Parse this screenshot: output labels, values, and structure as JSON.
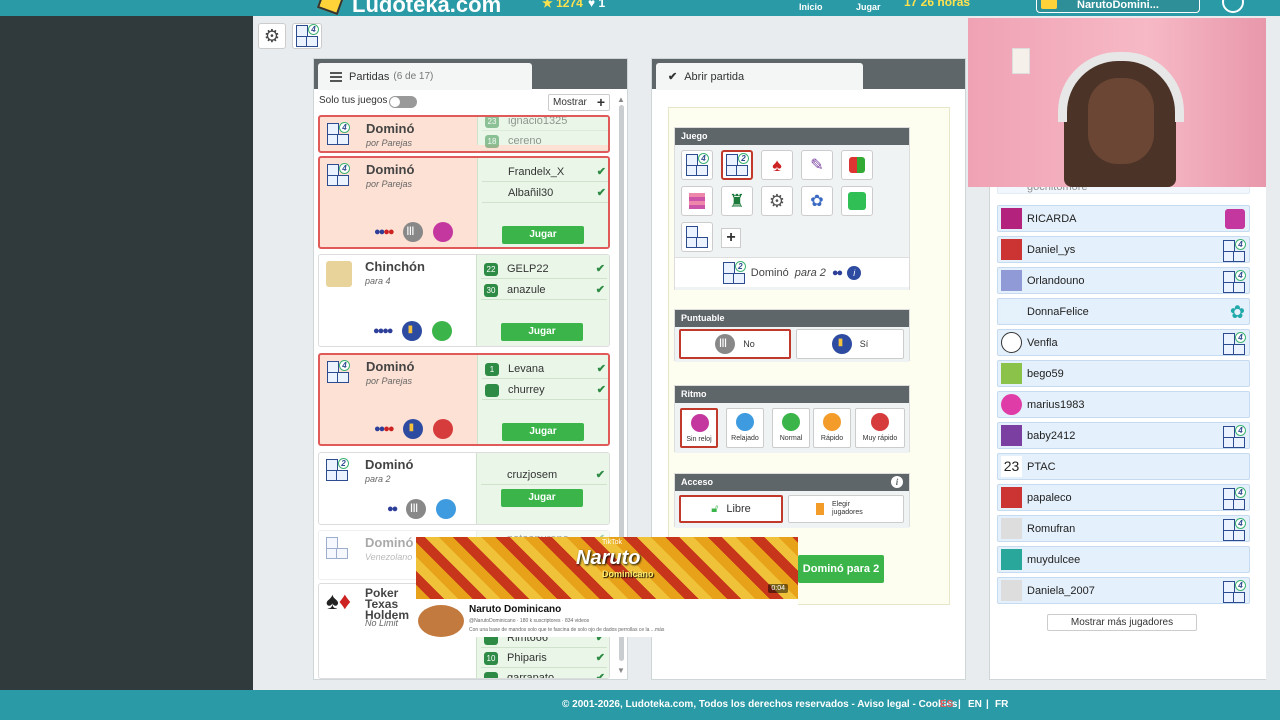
{
  "topbar": {
    "logo": "Ludoteka.com",
    "stat_stars": "1274",
    "stat_hearts": "1",
    "nav_inicio": "Inicio",
    "nav_jugar": "Jugar",
    "hours": "17 26 horas",
    "username": "NarutoDomini..."
  },
  "partidas": {
    "title": "Partidas",
    "count": "(6 de 17)",
    "filter_label": "Solo tus juegos",
    "mostrar": "Mostrar",
    "jugar": "Jugar",
    "games": [
      {
        "name": "Dominó",
        "sub": "por Parejas",
        "players": [
          "ignacio1325",
          "cereno"
        ],
        "levels": [
          "23",
          "18"
        ]
      },
      {
        "name": "Dominó",
        "sub": "por Parejas",
        "players": [
          "Frandelx_X",
          "Albañil30"
        ]
      },
      {
        "name": "Chinchón",
        "sub": "para 4",
        "players": [
          "GELP22",
          "anazule"
        ],
        "levels": [
          "22",
          "30"
        ]
      },
      {
        "name": "Dominó",
        "sub": "por Parejas",
        "players": [
          "Levana",
          "churrey"
        ],
        "levels": [
          "1",
          ""
        ]
      },
      {
        "name": "Dominó",
        "sub": "para 2",
        "players": [
          "cruzjosem"
        ]
      },
      {
        "name": "Dominó",
        "sub": "Venezolano",
        "players": [
          "natoapureno"
        ]
      },
      {
        "name": "Poker Texas Holdem",
        "sub": "No Limit",
        "players": [
          "Rimt666",
          "Phiparis",
          "garrapato"
        ],
        "levels": [
          "",
          "10",
          ""
        ]
      }
    ]
  },
  "abrir": {
    "title": "Abrir partida",
    "juego": "Juego",
    "selected_game": "Dominó",
    "selected_mode": "para 2",
    "puntuable": "Puntuable",
    "no": "No",
    "si": "Sí",
    "ritmo": "Ritmo",
    "ritmos": [
      "Sin reloj",
      "Relajado",
      "Normal",
      "Rápido",
      "Muy rápido"
    ],
    "acceso": "Acceso",
    "libre": "Libre",
    "elegir": "Elegir jugadores",
    "create": "Dominó para 2"
  },
  "players": {
    "list": [
      "gochitomore",
      "RICARDA",
      "Daniel_ys",
      "Orlandouno",
      "DonnaFelice",
      "Venfla",
      "bego59",
      "marius1983",
      "baby2412",
      "PTAC",
      "papaleco",
      "Romufran",
      "muydulcee",
      "Daniela_2007"
    ],
    "ptac_badge": "23",
    "more": "Mostrar más jugadores"
  },
  "promo": {
    "title": "Naruto",
    "subtitle": "Dominicano",
    "channel": "Naruto Dominicano",
    "handle": "@NarutoDominicano · 180 k suscriptores · 834 videos",
    "desc": "Con una base de mandos solo que te fascina de solo ojo de dados perrollas ce la ...más",
    "top": "TikTok",
    "time": "0:04"
  },
  "footer": {
    "copyright": "© 2001-2026, Ludoteka.com, Todos los derechos reservados - Aviso legal - Cookies",
    "lang_es": "ES",
    "lang_en": "EN",
    "lang_fr": "FR",
    "sep": "|"
  },
  "colors": {
    "accent": "#2a9aa6",
    "jugar": "#3bb54a",
    "selected": "#c0392b"
  }
}
